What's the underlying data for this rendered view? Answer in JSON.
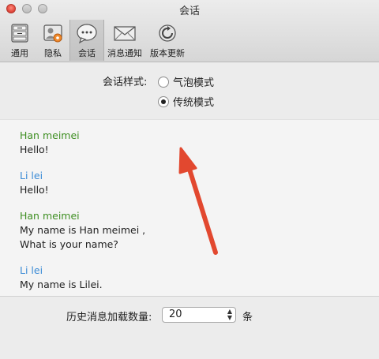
{
  "window": {
    "title": "会话"
  },
  "toolbar": {
    "items": [
      {
        "label": "通用",
        "icon": "general-icon"
      },
      {
        "label": "隐私",
        "icon": "privacy-icon"
      },
      {
        "label": "会话",
        "icon": "chat-icon",
        "selected": true
      },
      {
        "label": "消息通知",
        "icon": "mail-icon"
      },
      {
        "label": "版本更新",
        "icon": "update-icon"
      }
    ]
  },
  "chat_style": {
    "label": "会话样式:",
    "options": [
      {
        "label": "气泡模式",
        "checked": false
      },
      {
        "label": "传统模式",
        "checked": true
      }
    ]
  },
  "preview": {
    "messages": [
      {
        "sender": "Han meimei",
        "lines": [
          "Hello!"
        ],
        "color": "#3f8f23"
      },
      {
        "sender": "Li lei",
        "lines": [
          "Hello!"
        ],
        "color": "#3b8bd6"
      },
      {
        "sender": "Han meimei",
        "lines": [
          "My name is Han meimei ,",
          "What is your name?"
        ],
        "color": "#3f8f23"
      },
      {
        "sender": "Li lei",
        "lines": [
          "My name is Lilei."
        ],
        "color": "#3b8bd6"
      }
    ]
  },
  "history": {
    "label": "历史消息加载数量:",
    "value": "20",
    "unit": "条"
  },
  "annotation": {
    "arrow_color": "#e2482f"
  }
}
